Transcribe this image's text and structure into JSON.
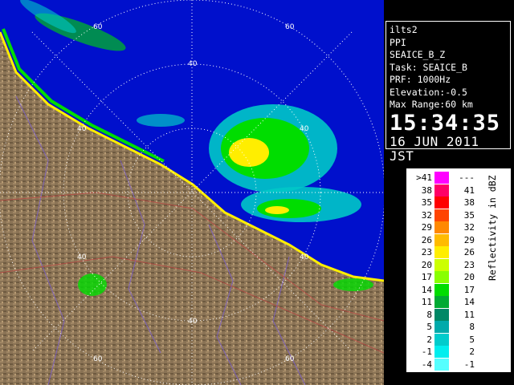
{
  "info": {
    "station": "ilts2",
    "mode": "PPI",
    "product": "SEAICE_B_Z",
    "task": "Task: SEAICE_B",
    "prf": "PRF: 1000Hz",
    "elevation": "Elevation:-0.5",
    "max_range": "Max Range:60 km",
    "time": "15:34:35",
    "date": "16 JUN 2011 JST"
  },
  "range_labels": [
    "60",
    "60",
    "40",
    "40",
    "40",
    "40",
    "40",
    "40",
    "60",
    "60"
  ],
  "legend": {
    "title": "Reflectivity in dBZ",
    "rows": [
      {
        "lo": ">41",
        "hi": "---",
        "color": "#ff00ff"
      },
      {
        "lo": "38",
        "hi": "41",
        "color": "#ff0066"
      },
      {
        "lo": "35",
        "hi": "38",
        "color": "#ff0000"
      },
      {
        "lo": "32",
        "hi": "35",
        "color": "#ff4400"
      },
      {
        "lo": "29",
        "hi": "32",
        "color": "#ff8800"
      },
      {
        "lo": "26",
        "hi": "29",
        "color": "#ffbb00"
      },
      {
        "lo": "23",
        "hi": "26",
        "color": "#ffee00"
      },
      {
        "lo": "20",
        "hi": "23",
        "color": "#ccff00"
      },
      {
        "lo": "17",
        "hi": "20",
        "color": "#88ff00"
      },
      {
        "lo": "14",
        "hi": "17",
        "color": "#00dd00"
      },
      {
        "lo": "11",
        "hi": "14",
        "color": "#00aa33"
      },
      {
        "lo": "8",
        "hi": "11",
        "color": "#008866"
      },
      {
        "lo": "5",
        "hi": "8",
        "color": "#00aaaa"
      },
      {
        "lo": "2",
        "hi": "5",
        "color": "#00cccc"
      },
      {
        "lo": "-1",
        "hi": "2",
        "color": "#00eeee"
      },
      {
        "lo": "-4",
        "hi": "-1",
        "color": "#55ffff"
      }
    ]
  },
  "colors": {
    "sea": "#0010cc",
    "land": "#8a7355",
    "echo_weak": "#00c8c8",
    "echo_mid": "#00dd00",
    "echo_strong": "#ffee00"
  }
}
